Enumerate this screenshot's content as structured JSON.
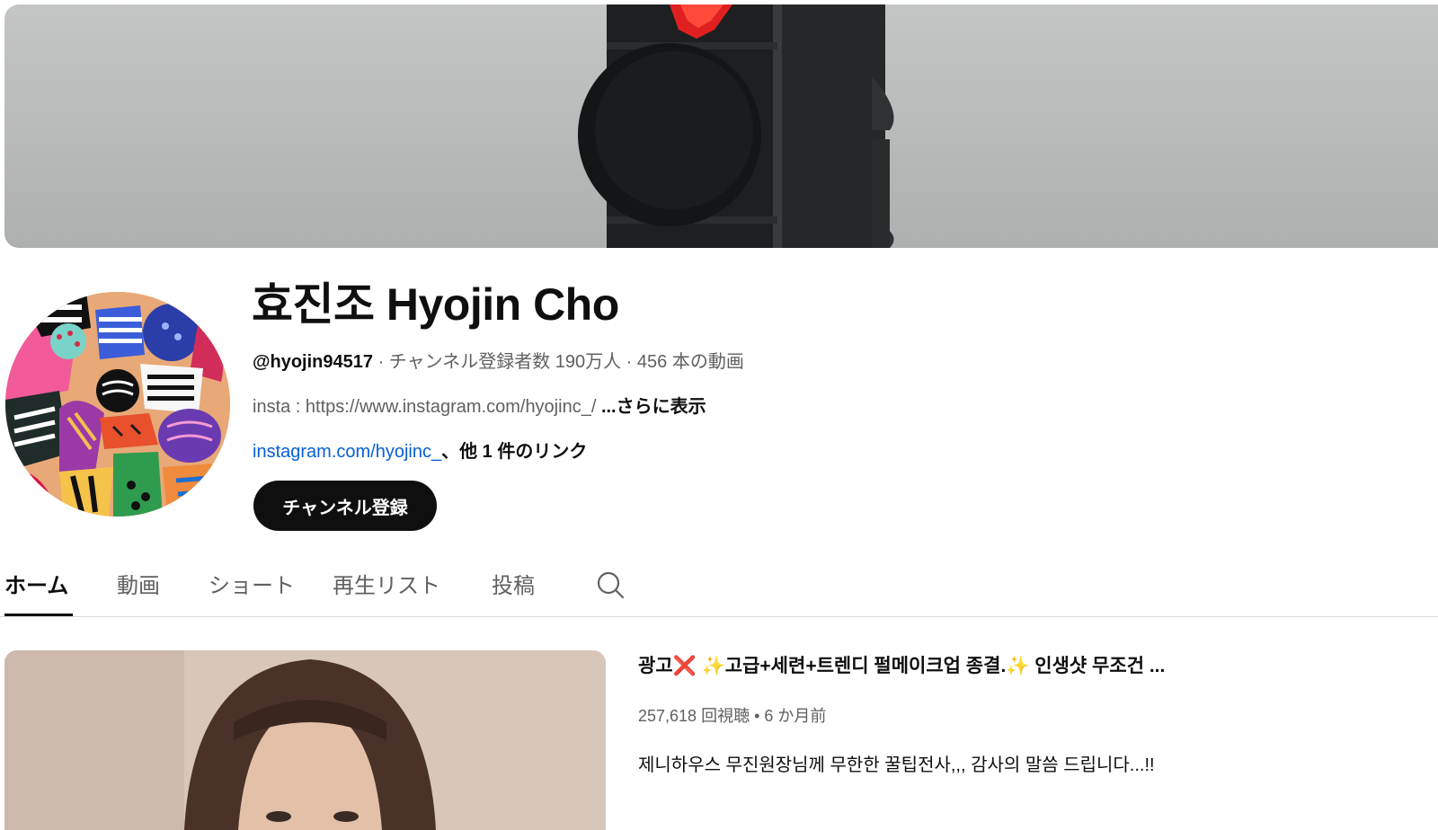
{
  "channel": {
    "name": "효진조 Hyojin Cho",
    "handle": "@hyojin94517",
    "subscribers": "チャンネル登録者数 190万人",
    "video_count": "456 本の動画",
    "separator": " · ",
    "description": "insta : https://www.instagram.com/hyojinc_/ ",
    "more_label": "...さらに表示",
    "link_text": "instagram.com/hyojinc_",
    "other_links": "、他 1 件のリンク",
    "subscribe_label": "チャンネル登録"
  },
  "tabs": [
    {
      "label": "ホーム",
      "active": true
    },
    {
      "label": "動画",
      "active": false
    },
    {
      "label": "ショート",
      "active": false
    },
    {
      "label": "再生リスト",
      "active": false
    },
    {
      "label": "投稿",
      "active": false
    }
  ],
  "tab_search_icon": "search-icon",
  "featured_video": {
    "title": "광고❌ ✨고급+세련+트렌디 펄메이크업 종결.✨ 인생샷 무조건 ...",
    "views": "257,618 回視聴",
    "age": "6 か月前",
    "meta_separator": " • ",
    "description": "제니하우스 무진원장님께 무한한 꿀팁전사,,, 감사의 말씀 드립니다...!!"
  },
  "colors": {
    "link": "#065fd4",
    "text_primary": "#0f0f0f",
    "text_secondary": "#606060",
    "subscribe_bg": "#0f0f0f",
    "traffic_light_red": "#e02020"
  }
}
